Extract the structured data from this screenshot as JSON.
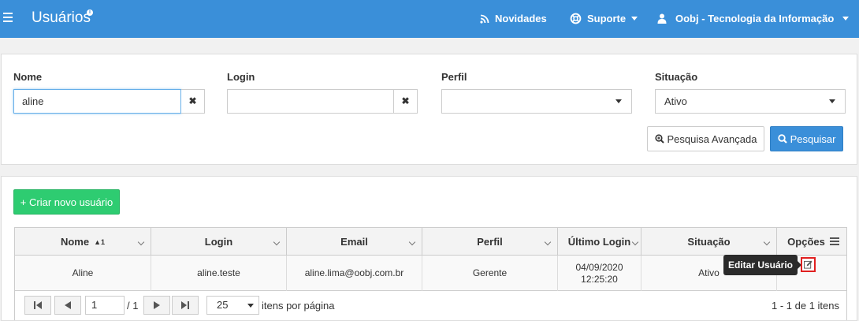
{
  "header": {
    "title": "Usuários",
    "info_badge": "i",
    "nav": {
      "novidades": "Novidades",
      "suporte": "Suporte",
      "user": "Oobj - Tecnologia da Informação"
    },
    "icons": {
      "menu": "hamburger-icon",
      "novidades": "rss-icon",
      "suporte": "lifebuoy-icon",
      "user": "user-icon"
    },
    "color": "#3a8fd9"
  },
  "filters": {
    "nome": {
      "label": "Nome",
      "value": "aline"
    },
    "login": {
      "label": "Login",
      "value": ""
    },
    "perfil": {
      "label": "Perfil",
      "value": ""
    },
    "situacao": {
      "label": "Situação",
      "value": "Ativo"
    },
    "advanced_search_label": "Pesquisa Avançada",
    "search_label": "Pesquisar",
    "clear_glyph": "✖"
  },
  "results": {
    "create_label": "+ Criar novo usuário",
    "columns": {
      "nome": "Nome",
      "nome_sort": "▲1",
      "login": "Login",
      "email": "Email",
      "perfil": "Perfil",
      "ultimo_login": "Último Login",
      "situacao": "Situação",
      "opcoes": "Opções"
    },
    "rows": [
      {
        "nome": "Aline",
        "login": "aline.teste",
        "email": "aline.lima@oobj.com.br",
        "perfil": "Gerente",
        "ultimo_login_date": "04/09/2020",
        "ultimo_login_time": "12:25:20",
        "situacao": "Ativo"
      }
    ],
    "tooltip": "Editar Usuário",
    "pager": {
      "page": "1",
      "of": "/ 1",
      "page_size": "25",
      "per_page_label": "itens por página",
      "summary": "1 - 1 de 1 itens"
    }
  }
}
